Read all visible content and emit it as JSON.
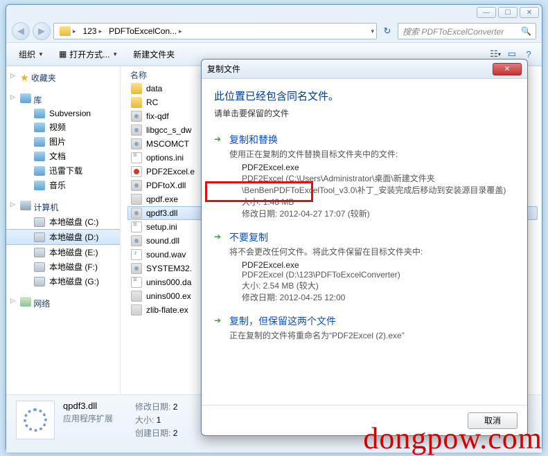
{
  "window": {
    "breadcrumb": [
      "123",
      "PDFToExcelCon..."
    ],
    "search_placeholder": "搜索 PDFToExcelConverter"
  },
  "toolbar": {
    "organize": "组织",
    "openwith": "打开方式...",
    "newfolder": "新建文件夹"
  },
  "nav": {
    "favorites": "收藏夹",
    "libraries": "库",
    "lib_items": [
      "Subversion",
      "视频",
      "图片",
      "文档",
      "迅雷下载",
      "音乐"
    ],
    "computer": "计算机",
    "drives": [
      "本地磁盘 (C:)",
      "本地磁盘 (D:)",
      "本地磁盘 (E:)",
      "本地磁盘 (F:)",
      "本地磁盘 (G:)"
    ],
    "network": "网络"
  },
  "filelist": {
    "col_name": "名称",
    "items": [
      {
        "name": "data",
        "type": "folder"
      },
      {
        "name": "RC",
        "type": "folder"
      },
      {
        "name": "fix-qdf",
        "type": "dll"
      },
      {
        "name": "libgcc_s_dw",
        "type": "dll"
      },
      {
        "name": "MSCOMCT",
        "type": "dll"
      },
      {
        "name": "options.ini",
        "type": "ini"
      },
      {
        "name": "PDF2Excel.e",
        "type": "pdf"
      },
      {
        "name": "PDFtoX.dll",
        "type": "dll"
      },
      {
        "name": "qpdf.exe",
        "type": "exe"
      },
      {
        "name": "qpdf3.dll",
        "type": "dll",
        "selected": true
      },
      {
        "name": "setup.ini",
        "type": "ini"
      },
      {
        "name": "sound.dll",
        "type": "dll"
      },
      {
        "name": "sound.wav",
        "type": "wav"
      },
      {
        "name": "SYSTEM32.",
        "type": "dll"
      },
      {
        "name": "unins000.da",
        "type": "ini"
      },
      {
        "name": "unins000.ex",
        "type": "exe"
      },
      {
        "name": "zlib-flate.ex",
        "type": "exe"
      }
    ]
  },
  "details": {
    "name": "qpdf3.dll",
    "type": "应用程序扩展",
    "modlabel": "修改日期:",
    "modval": "2",
    "sizelabel": "大小:",
    "sizeval": "1",
    "createlabel": "创建日期:",
    "createval": "2"
  },
  "dialog": {
    "title": "复制文件",
    "heading": "此位置已经包含同名文件。",
    "sub": "请单击要保留的文件",
    "opt1": {
      "title": "复制和替换",
      "desc": "使用正在复制的文件替换目标文件夹中的文件:",
      "fname": "PDF2Excel.exe",
      "path": "PDF2Excel (C:\\Users\\Administrator\\桌面\\新建文件夹\\BenBenPDFToExcelTool_v3.0\\补丁_安装完成后移动到安装源目录覆盖)",
      "size": "大小: 1.48 MB",
      "date": "修改日期: 2012-04-27 17:07 (较新)"
    },
    "opt2": {
      "title": "不要复制",
      "desc": "将不会更改任何文件。将此文件保留在目标文件夹中:",
      "fname": "PDF2Excel.exe",
      "path": "PDF2Excel (D:\\123\\PDFToExcelConverter)",
      "size": "大小: 2.54 MB (较大)",
      "date": "修改日期: 2012-04-25 12:00"
    },
    "opt3": {
      "title": "复制，但保留这两个文件",
      "desc": "正在复制的文件将重命名为“PDF2Excel (2).exe”"
    },
    "cancel": "取消"
  },
  "watermark": "dongpow.com"
}
